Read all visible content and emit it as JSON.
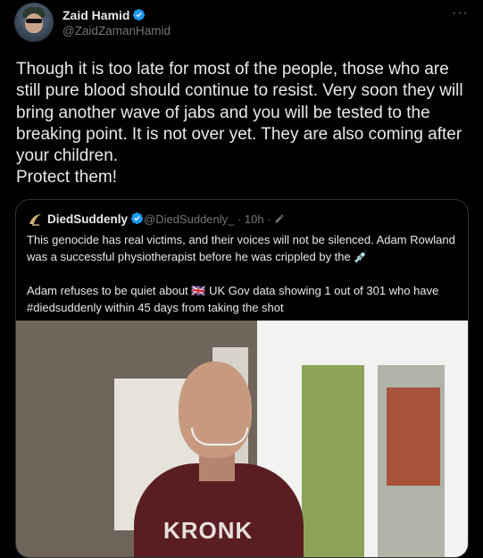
{
  "author": {
    "name": "Zaid Hamid",
    "handle": "@ZaidZamanHamid",
    "verified_icon": "verified-badge-icon",
    "more_label": "···"
  },
  "tweet": {
    "text": "Though it is too late for most of the people, those who are still pure blood should continue to resist. Very soon they will bring another wave of jabs and you will be tested to the breaking point. It is not over yet. They are also coming after your children.\nProtect them!"
  },
  "quoted": {
    "name": "DiedSuddenly",
    "handle_time": "@DiedSuddenly_ · 10h ·",
    "text": "This genocide has real victims, and their voices will not be silenced. Adam Rowland was a successful physiotherapist before he was crippled by the 💉\n\nAdam refuses to be quiet about 🇬🇧 UK Gov data showing 1 out of 301 who have #diedsuddenly within 45 days from taking the shot",
    "media_text": "KRONK"
  },
  "colors": {
    "background": "#000000",
    "text": "#e7e9ea",
    "secondary": "#71767b",
    "verified": "#1d9bf0",
    "border": "#2f3336"
  }
}
